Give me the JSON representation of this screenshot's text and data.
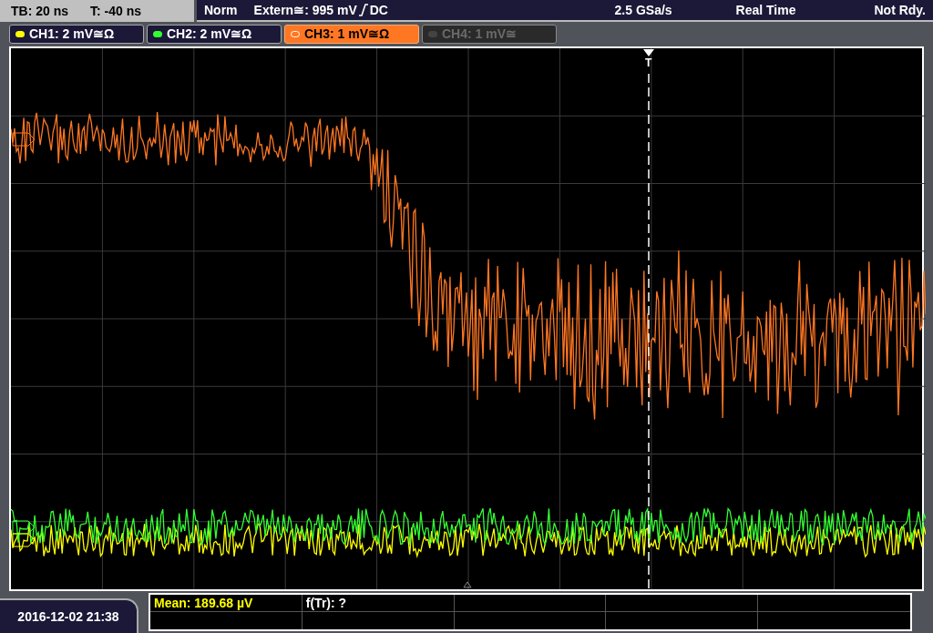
{
  "status_bar": {
    "timebase": "TB: 20 ns",
    "trigger_offset": "T: -40 ns",
    "mode": "Norm",
    "trigger_source": "Extern≅: 995 mV",
    "coupling": "DC",
    "sample_rate": "2.5 GSa/s",
    "acquisition": "Real Time",
    "status": "Not Rdy."
  },
  "channels": [
    {
      "label": "CH1: 2 mV≅Ω",
      "color": "#ffff00",
      "selected": false,
      "active": true
    },
    {
      "label": "CH2: 2 mV≅Ω",
      "color": "#33ff33",
      "selected": false,
      "active": true
    },
    {
      "label": "CH3: 1 mV≅Ω",
      "color": "#ff7722",
      "selected": true,
      "active": true
    },
    {
      "label": "CH4: 1 mV≅",
      "color": "#444444",
      "selected": false,
      "active": false
    }
  ],
  "trigger_marker": "T",
  "measurements": [
    {
      "text": "Mean: 189.68 µV",
      "color": "#ffff00"
    },
    {
      "text": "f(Tr): ?",
      "color": "#ffffff"
    }
  ],
  "datetime": "2016-12-02 21:38"
}
